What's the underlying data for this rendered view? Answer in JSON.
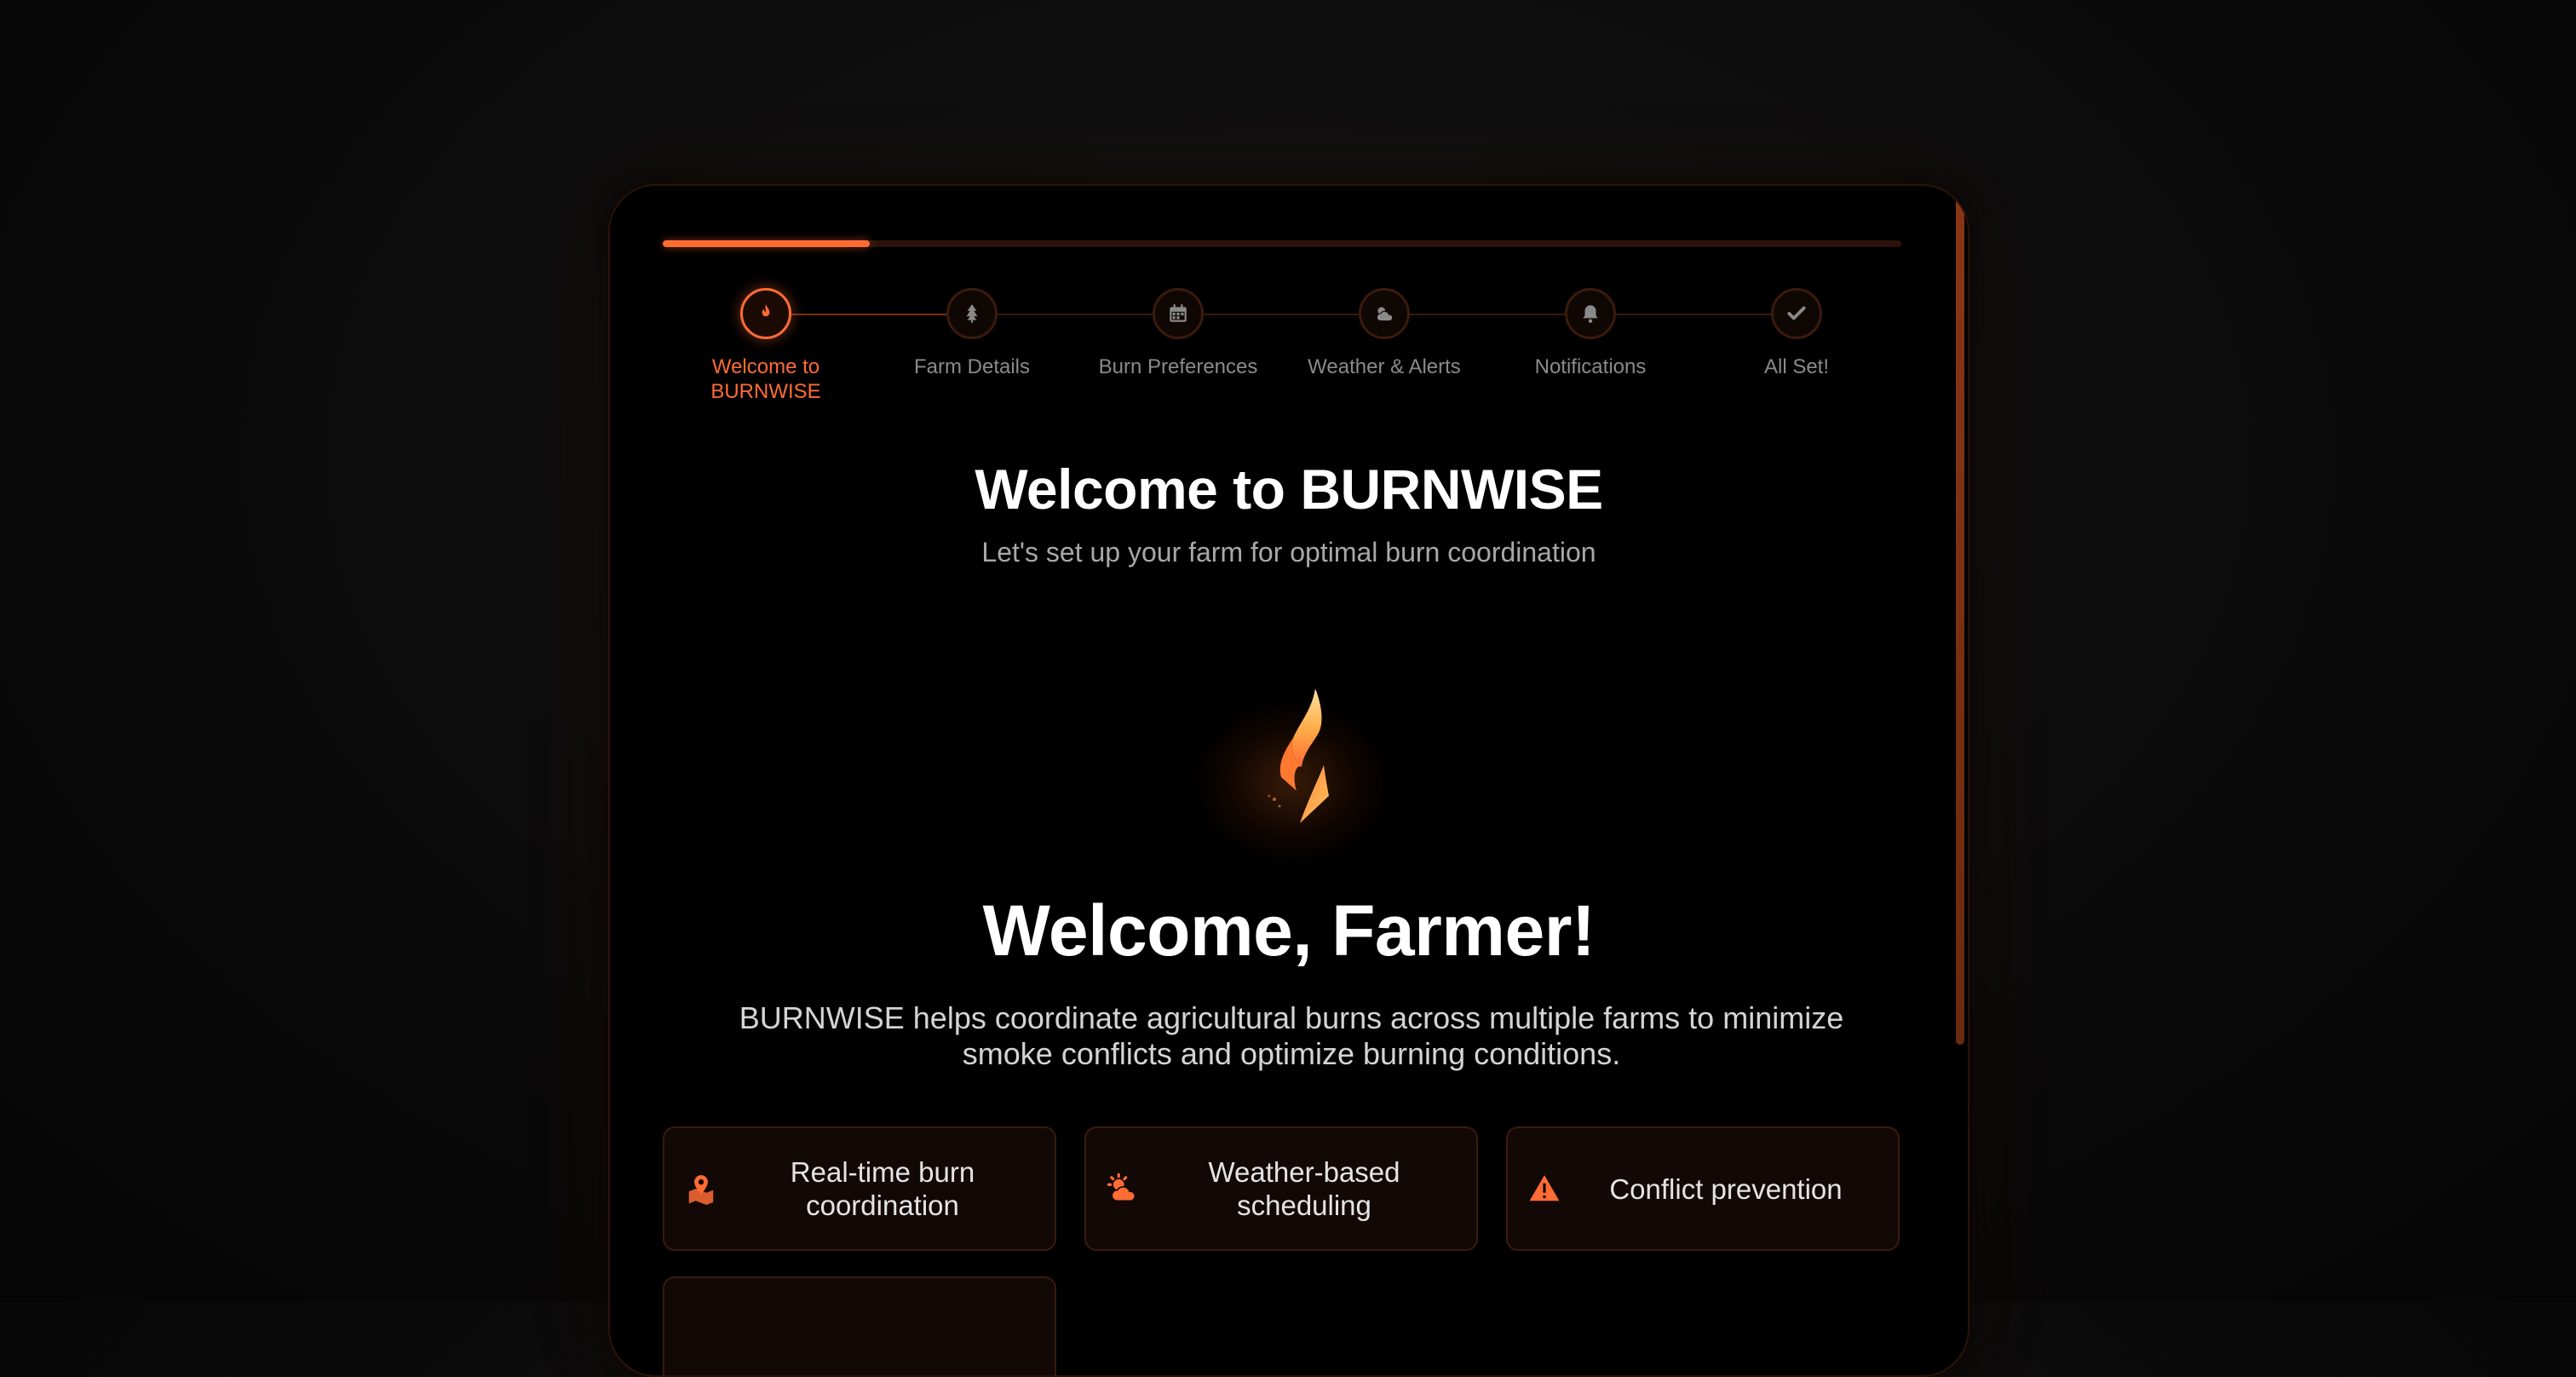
{
  "progress": {
    "value": 0.167
  },
  "steps": [
    {
      "label": "Welcome to BURNWISE",
      "icon": "flame-icon",
      "active": true
    },
    {
      "label": "Farm Details",
      "icon": "tree-icon",
      "active": false
    },
    {
      "label": "Burn Preferences",
      "icon": "calendar-icon",
      "active": false
    },
    {
      "label": "Weather & Alerts",
      "icon": "cloud-sun-icon",
      "active": false
    },
    {
      "label": "Notifications",
      "icon": "bell-icon",
      "active": false
    },
    {
      "label": "All Set!",
      "icon": "check-icon",
      "active": false
    }
  ],
  "header": {
    "title": "Welcome to BURNWISE",
    "subtitle": "Let's set up your farm for optimal burn coordination"
  },
  "logo": {
    "icon": "burnwise-flame-logo"
  },
  "main": {
    "heading": "Welcome, Farmer!",
    "description": "BURNWISE helps coordinate agricultural burns across multiple farms to minimize smoke conflicts and optimize burning conditions."
  },
  "features": [
    {
      "label": "Real-time burn coordination",
      "icon": "map-marker-icon"
    },
    {
      "label": "Weather-based scheduling",
      "icon": "cloud-sun-icon"
    },
    {
      "label": "Conflict prevention",
      "icon": "warning-icon"
    }
  ],
  "colors": {
    "accent": "#ff6b35",
    "background": "#000000",
    "card_border": "#2a130a",
    "muted_text": "#8a8a8a"
  }
}
